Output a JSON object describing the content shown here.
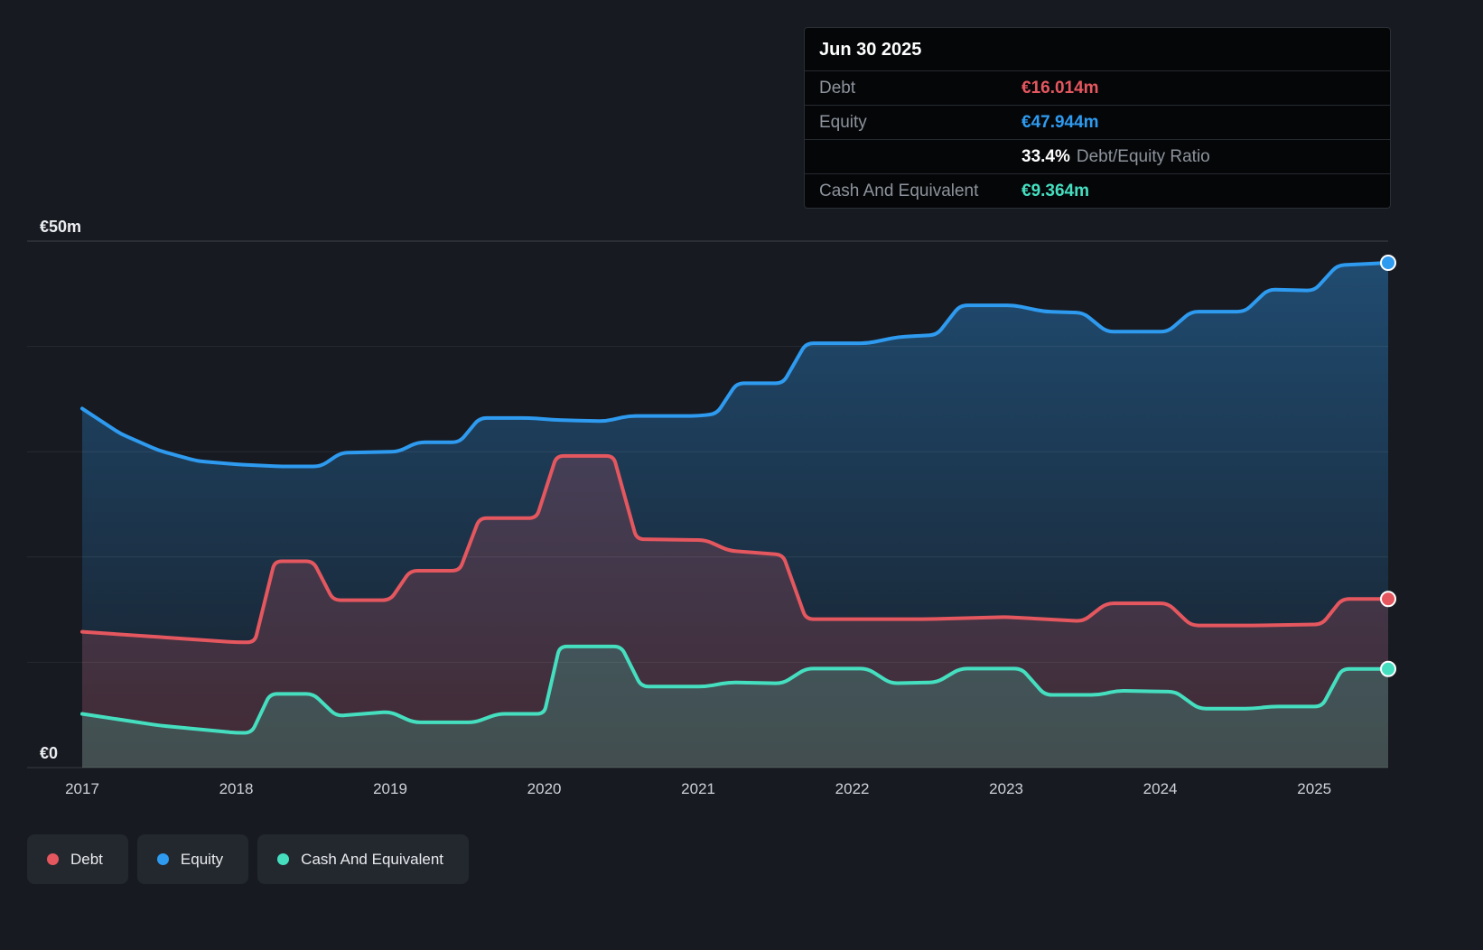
{
  "page": {
    "background": "#171a21"
  },
  "tooltip": {
    "title": "Jun 30 2025",
    "rows": [
      {
        "label": "Debt",
        "value": "€16.014m",
        "series": "debt"
      },
      {
        "label": "Equity",
        "value": "€47.944m",
        "series": "equity"
      },
      {
        "label": "Cash And Equivalent",
        "value": "€9.364m",
        "series": "cash"
      }
    ],
    "ratio_value": "33.4%",
    "ratio_label": "Debt/Equity Ratio"
  },
  "legend": {
    "items": [
      {
        "label": "Debt",
        "series": "debt"
      },
      {
        "label": "Equity",
        "series": "equity"
      },
      {
        "label": "Cash And Equivalent",
        "series": "cash"
      }
    ]
  },
  "axis": {
    "y_labels": [
      {
        "text": "€50m",
        "value": 50
      },
      {
        "text": "€0",
        "value": 0
      }
    ],
    "x_ticks": [
      {
        "label": "2017",
        "value": 2017
      },
      {
        "label": "2018",
        "value": 2018
      },
      {
        "label": "2019",
        "value": 2019
      },
      {
        "label": "2020",
        "value": 2020
      },
      {
        "label": "2021",
        "value": 2021
      },
      {
        "label": "2022",
        "value": 2022
      },
      {
        "label": "2023",
        "value": 2023
      },
      {
        "label": "2024",
        "value": 2024
      },
      {
        "label": "2025",
        "value": 2025
      }
    ]
  },
  "chart_data": {
    "type": "area",
    "x_unit": "year",
    "y_unit": "€ millions",
    "x_range": [
      2017.0,
      2025.48
    ],
    "ylim": [
      0,
      50
    ],
    "grid": true,
    "gridlines": [
      0,
      10,
      20,
      30,
      40,
      50
    ],
    "legend_position": "bottom-left",
    "series": [
      {
        "key": "equity",
        "name": "Equity",
        "color": "#2e9bf0",
        "fill": "gradient",
        "end_value": 47.944,
        "points": [
          [
            2017.0,
            34.1
          ],
          [
            2017.25,
            31.7
          ],
          [
            2017.5,
            30.1
          ],
          [
            2017.75,
            29.1
          ],
          [
            2018.0,
            28.8
          ],
          [
            2018.3,
            28.6
          ],
          [
            2018.55,
            28.6
          ],
          [
            2018.68,
            29.9
          ],
          [
            2019.05,
            30.0
          ],
          [
            2019.18,
            30.9
          ],
          [
            2019.45,
            30.9
          ],
          [
            2019.58,
            33.2
          ],
          [
            2019.9,
            33.2
          ],
          [
            2020.1,
            33.0
          ],
          [
            2020.4,
            32.9
          ],
          [
            2020.55,
            33.4
          ],
          [
            2021.0,
            33.4
          ],
          [
            2021.12,
            33.6
          ],
          [
            2021.25,
            36.5
          ],
          [
            2021.55,
            36.5
          ],
          [
            2021.7,
            40.3
          ],
          [
            2022.1,
            40.3
          ],
          [
            2022.3,
            40.9
          ],
          [
            2022.55,
            41.1
          ],
          [
            2022.7,
            43.9
          ],
          [
            2023.05,
            43.9
          ],
          [
            2023.25,
            43.3
          ],
          [
            2023.5,
            43.2
          ],
          [
            2023.65,
            41.4
          ],
          [
            2024.05,
            41.4
          ],
          [
            2024.2,
            43.3
          ],
          [
            2024.55,
            43.3
          ],
          [
            2024.7,
            45.4
          ],
          [
            2025.0,
            45.3
          ],
          [
            2025.15,
            47.7
          ],
          [
            2025.48,
            47.944
          ]
        ]
      },
      {
        "key": "debt",
        "name": "Debt",
        "color": "#e5575f",
        "fill": "rgba(229,87,95,0.20)",
        "end_value": 16.014,
        "points": [
          [
            2017.0,
            12.9
          ],
          [
            2017.5,
            12.4
          ],
          [
            2018.0,
            11.9
          ],
          [
            2018.12,
            11.9
          ],
          [
            2018.25,
            19.6
          ],
          [
            2018.5,
            19.6
          ],
          [
            2018.63,
            15.9
          ],
          [
            2019.0,
            15.9
          ],
          [
            2019.13,
            18.7
          ],
          [
            2019.45,
            18.7
          ],
          [
            2019.58,
            23.7
          ],
          [
            2019.95,
            23.7
          ],
          [
            2020.08,
            29.6
          ],
          [
            2020.45,
            29.6
          ],
          [
            2020.6,
            21.7
          ],
          [
            2021.05,
            21.6
          ],
          [
            2021.2,
            20.6
          ],
          [
            2021.55,
            20.2
          ],
          [
            2021.7,
            14.1
          ],
          [
            2022.5,
            14.1
          ],
          [
            2023.0,
            14.3
          ],
          [
            2023.5,
            13.9
          ],
          [
            2023.65,
            15.6
          ],
          [
            2024.05,
            15.6
          ],
          [
            2024.2,
            13.5
          ],
          [
            2024.6,
            13.5
          ],
          [
            2025.05,
            13.6
          ],
          [
            2025.18,
            16.014
          ],
          [
            2025.48,
            16.014
          ]
        ]
      },
      {
        "key": "cash",
        "name": "Cash And Equivalent",
        "color": "#45dfc0",
        "fill": "rgba(69,223,192,0.20)",
        "end_value": 9.364,
        "points": [
          [
            2017.0,
            5.1
          ],
          [
            2017.5,
            4.0
          ],
          [
            2018.0,
            3.3
          ],
          [
            2018.1,
            3.3
          ],
          [
            2018.22,
            7.0
          ],
          [
            2018.5,
            7.0
          ],
          [
            2018.65,
            4.9
          ],
          [
            2019.0,
            5.3
          ],
          [
            2019.15,
            4.3
          ],
          [
            2019.55,
            4.3
          ],
          [
            2019.7,
            5.1
          ],
          [
            2020.0,
            5.1
          ],
          [
            2020.1,
            11.5
          ],
          [
            2020.5,
            11.5
          ],
          [
            2020.63,
            7.7
          ],
          [
            2021.05,
            7.7
          ],
          [
            2021.2,
            8.1
          ],
          [
            2021.55,
            8.0
          ],
          [
            2021.7,
            9.4
          ],
          [
            2022.1,
            9.4
          ],
          [
            2022.25,
            8.0
          ],
          [
            2022.55,
            8.1
          ],
          [
            2022.7,
            9.4
          ],
          [
            2023.1,
            9.4
          ],
          [
            2023.25,
            6.9
          ],
          [
            2023.6,
            6.9
          ],
          [
            2023.72,
            7.3
          ],
          [
            2024.1,
            7.2
          ],
          [
            2024.25,
            5.6
          ],
          [
            2024.6,
            5.6
          ],
          [
            2024.72,
            5.8
          ],
          [
            2025.05,
            5.8
          ],
          [
            2025.18,
            9.364
          ],
          [
            2025.48,
            9.364
          ]
        ]
      }
    ]
  }
}
